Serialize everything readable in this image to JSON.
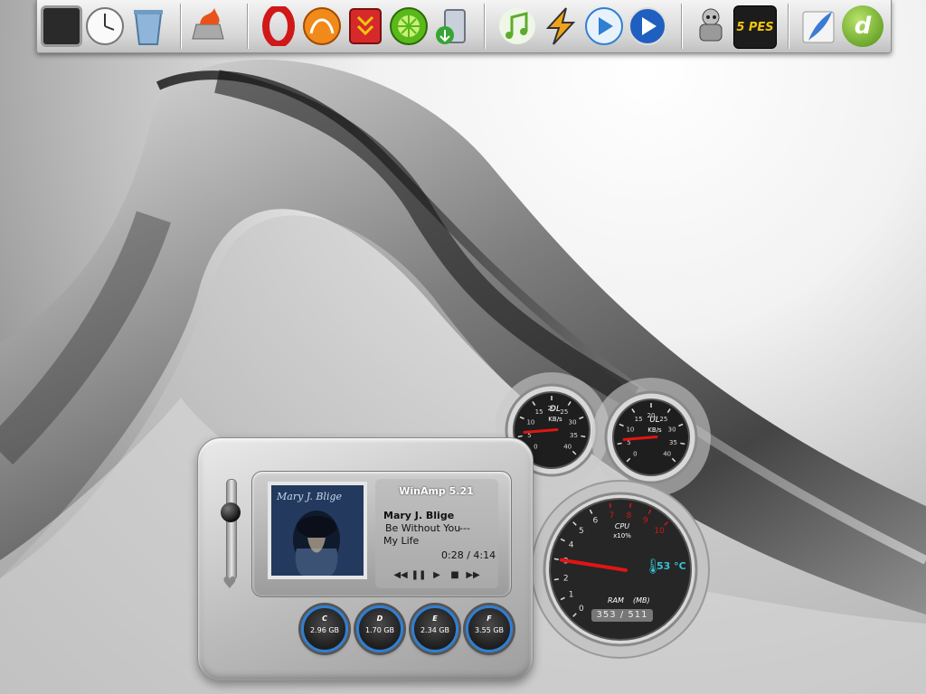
{
  "dock": {
    "icons": [
      {
        "name": "desktop-icon",
        "label": ""
      },
      {
        "name": "clock-icon",
        "label": ""
      },
      {
        "name": "recycle-bin-icon",
        "label": ""
      },
      {
        "name": "nero-icon",
        "label": ""
      },
      {
        "name": "opera-icon",
        "label": ""
      },
      {
        "name": "orange-app-icon",
        "label": ""
      },
      {
        "name": "download-manager-icon",
        "label": ""
      },
      {
        "name": "limewire-icon",
        "label": ""
      },
      {
        "name": "recycle-download-icon",
        "label": ""
      },
      {
        "name": "itunes-icon",
        "label": ""
      },
      {
        "name": "winamp-icon",
        "label": ""
      },
      {
        "name": "media-player-icon",
        "label": ""
      },
      {
        "name": "windows-media-player-icon",
        "label": ""
      },
      {
        "name": "game-character-icon",
        "label": ""
      },
      {
        "name": "pes5-icon",
        "label": "5 PES"
      },
      {
        "name": "feather-app-icon",
        "label": ""
      },
      {
        "name": "dreamweaver-icon",
        "label": "d"
      }
    ],
    "colors": {
      "bar": "#d6d6d6",
      "opera": "#d01818",
      "lime": "#59b81a",
      "pes": "#f1c40f"
    }
  },
  "player": {
    "app_title": "WinAmp 5.21",
    "album_label": "Mary J. Blige",
    "artist": "Mary J. Blige",
    "track": "Be Without You",
    "track_suffix": "---",
    "album": "My Life",
    "time": "0:28 / 4:14",
    "controls": [
      "previous",
      "pause",
      "play",
      "stop",
      "next"
    ],
    "volume_level": 0.7
  },
  "drives": [
    {
      "letter": "C",
      "size": "2.96 GB"
    },
    {
      "letter": "D",
      "size": "1.70 GB"
    },
    {
      "letter": "E",
      "size": "2.34 GB"
    },
    {
      "letter": "F",
      "size": "3.55 GB"
    }
  ],
  "gauges": {
    "download": {
      "label": "DL",
      "unit": "KB/s",
      "ticks": [
        "0",
        "5",
        "10",
        "15",
        "20",
        "25",
        "30",
        "35",
        "40"
      ],
      "value": 6
    },
    "upload": {
      "label": "UL",
      "unit": "KB/s",
      "ticks": [
        "0",
        "5",
        "10",
        "15",
        "20",
        "25",
        "30",
        "35",
        "40"
      ],
      "value": 6
    },
    "cpu": {
      "label": "CPU",
      "unit": "x10%",
      "ticks": [
        "0",
        "1",
        "2",
        "3",
        "4",
        "5",
        "6",
        "7",
        "8",
        "9",
        "10"
      ],
      "value": 3
    },
    "temperature": "53 °C",
    "ram": {
      "label": "RAM",
      "unit": "(MB)",
      "value": "353 / 511"
    }
  }
}
